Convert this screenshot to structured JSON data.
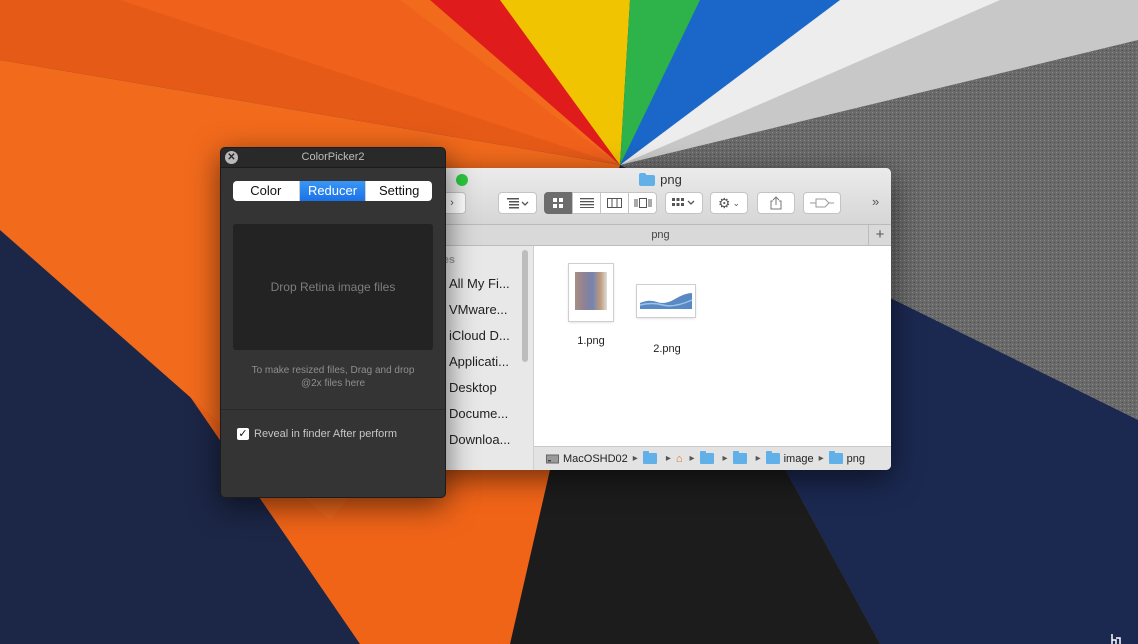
{
  "colorpicker": {
    "title": "ColorPicker2",
    "tabs": [
      "Color",
      "Reducer",
      "Setting"
    ],
    "selected_tab": "Reducer",
    "drop_zone_text": "Drop Retina image files",
    "hint_line1": "To make resized files, Drag and drop",
    "hint_line2": "@2x files here",
    "reveal_checkbox_label": "Reveal in finder After perform",
    "reveal_checked": true,
    "accent_color": "#1f7cf0"
  },
  "finder": {
    "title": "png",
    "tab_label": "png",
    "sidebar_header": "ites",
    "sidebar_items": [
      "All My Fi...",
      "VMware...",
      "iCloud D...",
      "Applicati...",
      "Desktop",
      "Docume...",
      "Downloa..."
    ],
    "files": [
      {
        "name": "1.png"
      },
      {
        "name": "2.png"
      }
    ],
    "path": [
      "MacOSHD02",
      "",
      "",
      "",
      "",
      "image",
      "png"
    ],
    "folder_color": "#62b0e8"
  }
}
